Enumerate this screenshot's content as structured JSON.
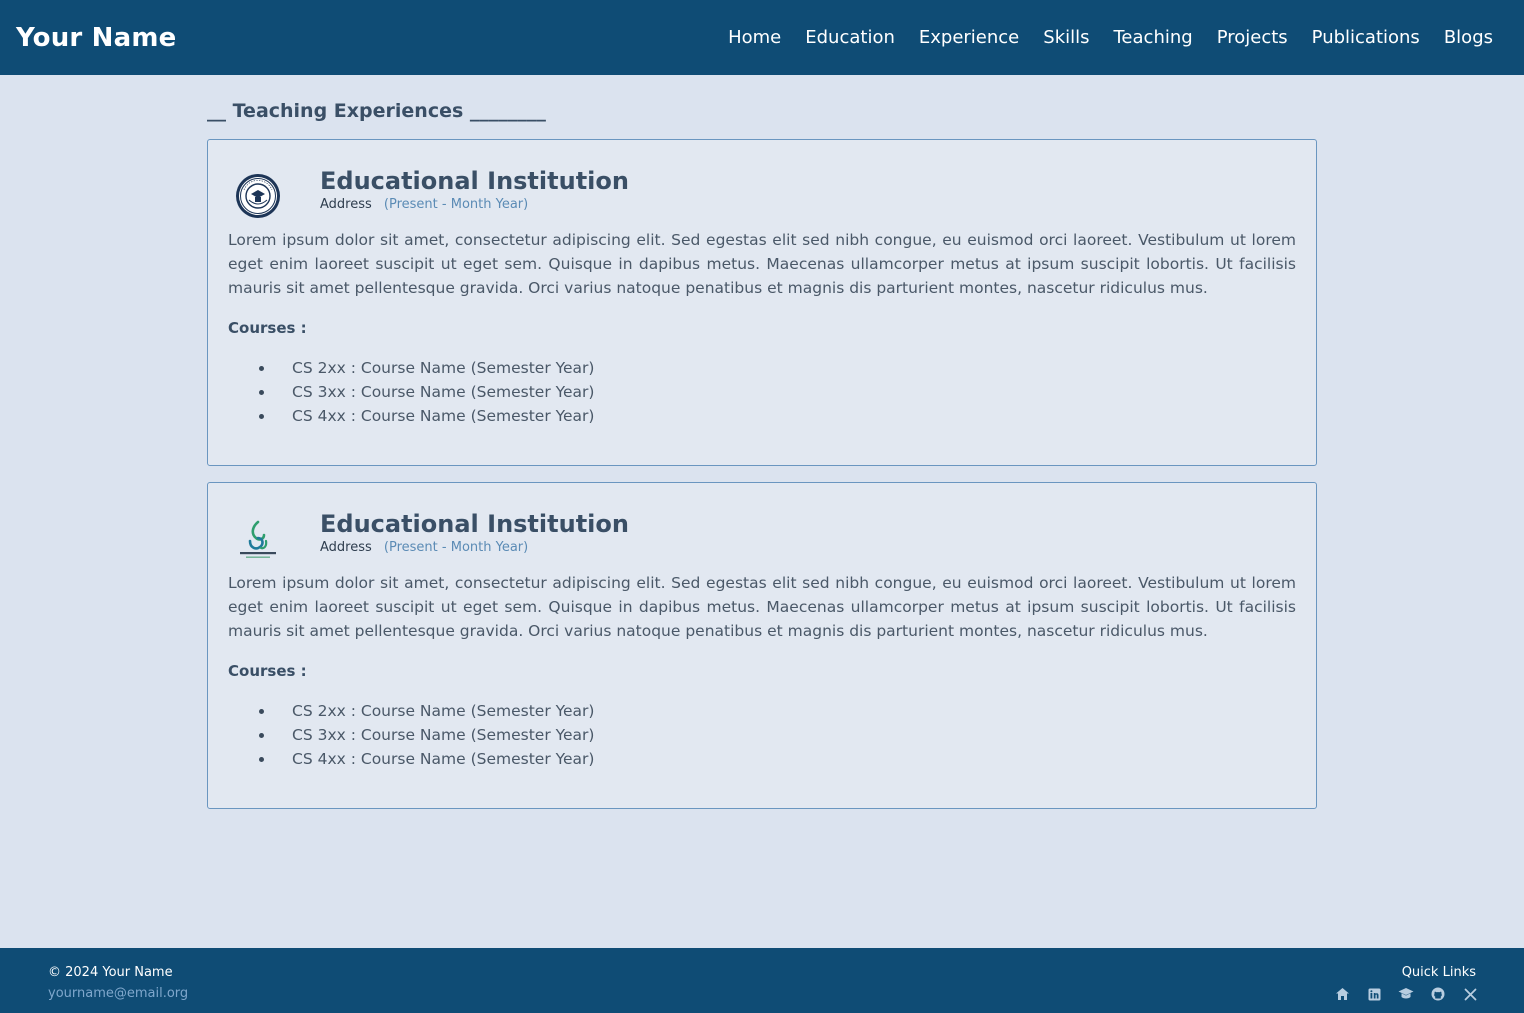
{
  "navbar": {
    "brand": "Your Name",
    "links": [
      "Home",
      "Education",
      "Experience",
      "Skills",
      "Teaching",
      "Projects",
      "Publications",
      "Blogs"
    ]
  },
  "section": {
    "title": "__ Teaching Experiences ________"
  },
  "experiences": [
    {
      "logo": "university-seal-icon",
      "institution": "Educational Institution",
      "address": "Address",
      "date": "(Present - Month Year)",
      "description": "Lorem ipsum dolor sit amet, consectetur adipiscing elit. Sed egestas elit sed nibh congue, eu euismod orci laoreet. Vestibulum ut lorem eget enim laoreet suscipit ut eget sem. Quisque in dapibus metus. Maecenas ullamcorper metus at ipsum suscipit lobortis. Ut facilisis mauris sit amet pellentesque gravida. Orci varius natoque penatibus et magnis dis parturient montes, nascetur ridiculus mus.",
      "courses_label": "Courses :",
      "courses": [
        "CS 2xx : Course Name (Semester Year)",
        "CS 3xx : Course Name (Semester Year)",
        "CS 4xx : Course Name (Semester Year)"
      ]
    },
    {
      "logo": "company-logo-icon",
      "institution": "Educational Institution",
      "address": "Address",
      "date": "(Present - Month Year)",
      "description": "Lorem ipsum dolor sit amet, consectetur adipiscing elit. Sed egestas elit sed nibh congue, eu euismod orci laoreet. Vestibulum ut lorem eget enim laoreet suscipit ut eget sem. Quisque in dapibus metus. Maecenas ullamcorper metus at ipsum suscipit lobortis. Ut facilisis mauris sit amet pellentesque gravida. Orci varius natoque penatibus et magnis dis parturient montes, nascetur ridiculus mus.",
      "courses_label": "Courses :",
      "courses": [
        "CS 2xx : Course Name (Semester Year)",
        "CS 3xx : Course Name (Semester Year)",
        "CS 4xx : Course Name (Semester Year)"
      ]
    }
  ],
  "footer": {
    "copyright": "© 2024 Your Name",
    "email": "yourname@email.org",
    "quick_links_title": "Quick Links",
    "quick_links": [
      "home-icon",
      "linkedin-icon",
      "graduation-cap-icon",
      "github-icon",
      "x-twitter-icon"
    ]
  },
  "colors": {
    "navbar_bg": "#0f4c75",
    "page_bg": "#dbe3ef",
    "card_border": "#6a96c0",
    "accent_date": "#5b8bb5"
  }
}
